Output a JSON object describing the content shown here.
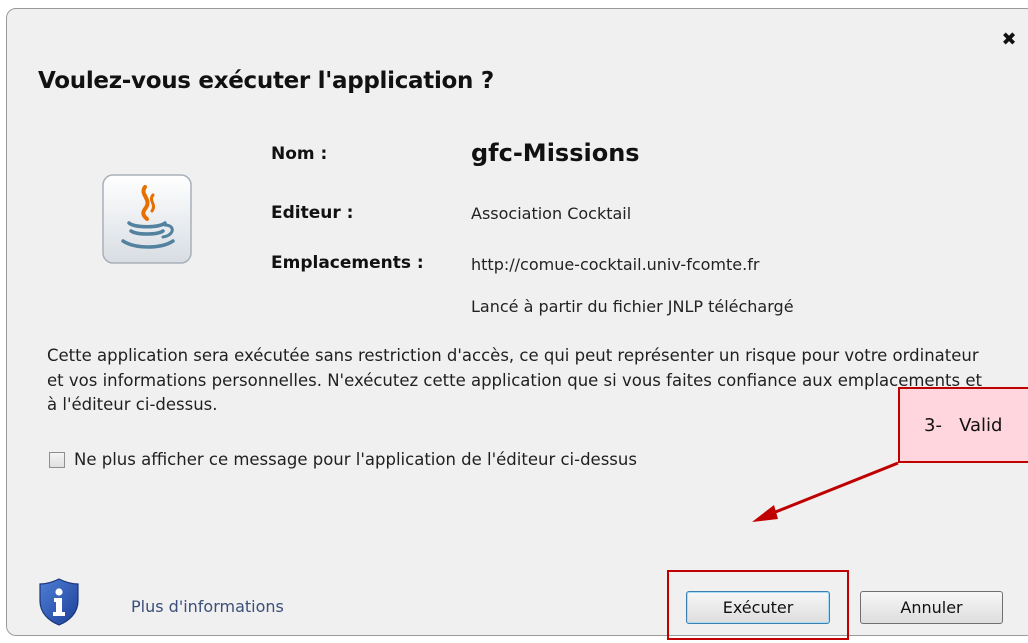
{
  "dialog": {
    "title": "Voulez-vous exécuter l'application ?",
    "close_glyph": "✖",
    "fields": {
      "name_label": "Nom :",
      "name_value": "gfc-Missions",
      "publisher_label": "Editeur :",
      "publisher_value": "Association Cocktail",
      "locations_label": "Emplacements :",
      "location_url": "http://comue-cocktail.univ-fcomte.fr",
      "location_source": "Lancé à partir du fichier JNLP téléchargé"
    },
    "description": "Cette application sera exécutée sans restriction d'accès, ce qui peut représenter un risque pour votre ordinateur et vos informations personnelles. N'exécutez cette application que si vous faites confiance aux emplacements et à l'éditeur ci-dessus.",
    "checkbox": {
      "label": "Ne plus afficher ce message pour l'application de l'éditeur ci-dessus",
      "checked": false
    },
    "more_info": "Plus d'informations",
    "buttons": {
      "run": "Exécuter",
      "cancel": "Annuler"
    },
    "icons": {
      "app": "java-cup-icon",
      "info": "info-shield-icon",
      "close": "close-icon"
    }
  },
  "annotation": {
    "callout_text": "3-   Valid",
    "highlight_color": "#c00000",
    "callout_fill": "#ffd5de"
  }
}
